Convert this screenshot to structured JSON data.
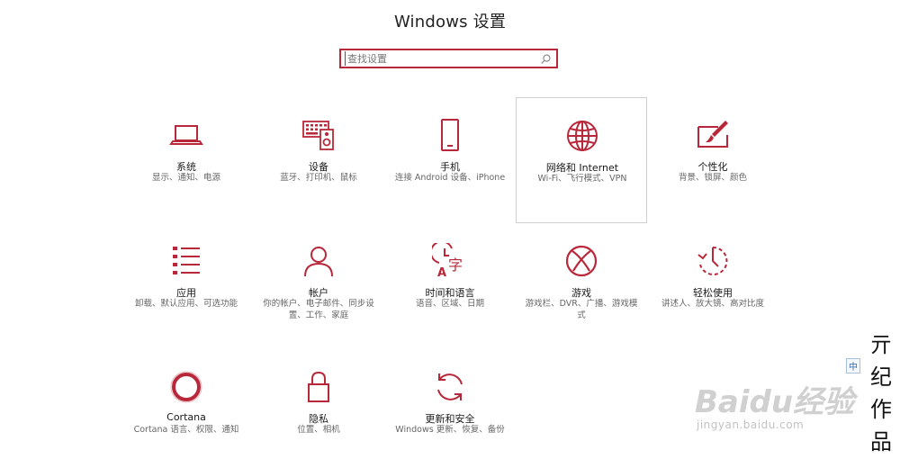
{
  "window": {
    "title": "Windows 设置"
  },
  "search": {
    "placeholder": "查找设置"
  },
  "accent": "#b8283a",
  "tiles": [
    {
      "id": "system",
      "icon": "laptop-icon",
      "label": "系统",
      "desc": "显示、通知、电源"
    },
    {
      "id": "devices",
      "icon": "keyboard-speaker-icon",
      "label": "设备",
      "desc": "蓝牙、打印机、鼠标"
    },
    {
      "id": "phone",
      "icon": "phone-icon",
      "label": "手机",
      "desc": "连接 Android 设备、iPhone"
    },
    {
      "id": "network",
      "icon": "globe-icon",
      "label": "网络和 Internet",
      "desc": "Wi-Fi、飞行模式、VPN",
      "selected": true
    },
    {
      "id": "personalization",
      "icon": "paint-brush-icon",
      "label": "个性化",
      "desc": "背景、锁屏、颜色"
    },
    {
      "id": "apps",
      "icon": "app-list-icon",
      "label": "应用",
      "desc": "卸载、默认应用、可选功能"
    },
    {
      "id": "accounts",
      "icon": "person-icon",
      "label": "帐户",
      "desc": "你的帐户、电子邮件、同步设置、工作、家庭"
    },
    {
      "id": "time",
      "icon": "time-language-icon",
      "label": "时间和语言",
      "desc": "语音、区域、日期"
    },
    {
      "id": "gaming",
      "icon": "xbox-icon",
      "label": "游戏",
      "desc": "游戏栏、DVR、广播、游戏模式"
    },
    {
      "id": "ease",
      "icon": "ease-of-access-icon",
      "label": "轻松使用",
      "desc": "讲述人、放大镜、高对比度"
    },
    {
      "id": "cortana",
      "icon": "cortana-ring-icon",
      "label": "Cortana",
      "desc": "Cortana 语言、权限、通知"
    },
    {
      "id": "privacy",
      "icon": "lock-icon",
      "label": "隐私",
      "desc": "位置、相机"
    },
    {
      "id": "update",
      "icon": "refresh-icon",
      "label": "更新和安全",
      "desc": "Windows 更新、恢复、备份"
    }
  ],
  "ime": {
    "label": "中"
  },
  "watermark": {
    "brand": "Baidu经验",
    "url": "jingyan.baidu.com",
    "author_sign": "亓纪作品"
  }
}
